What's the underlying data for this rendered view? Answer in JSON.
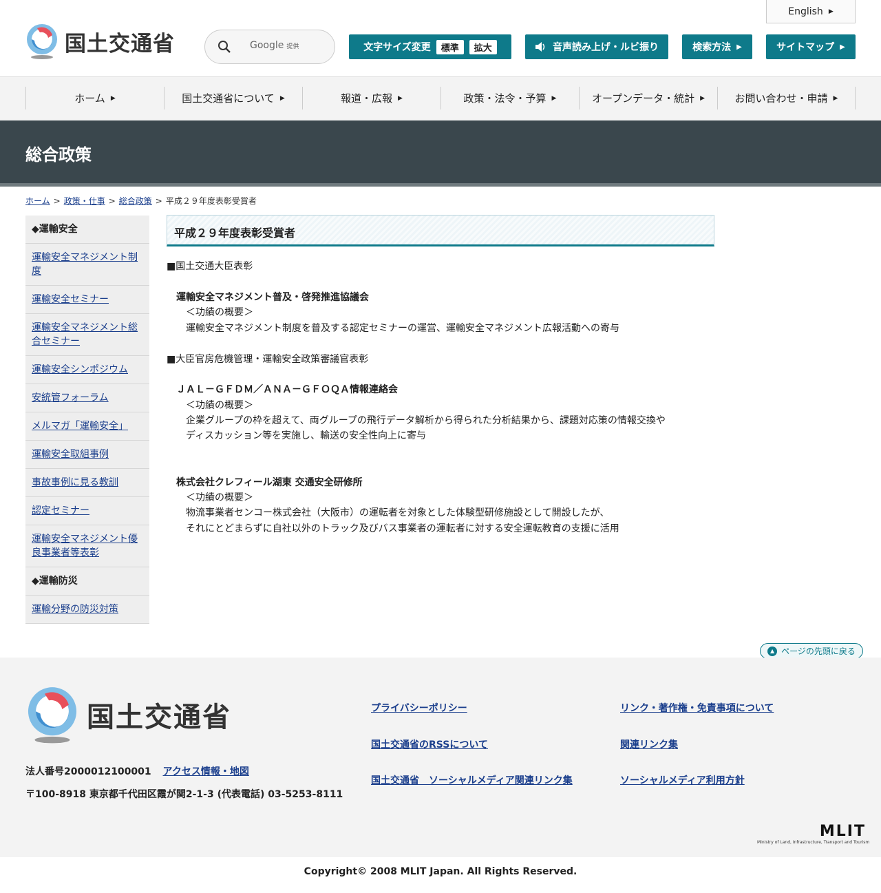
{
  "header": {
    "logo_text": "国土交通省",
    "search_brand": "Google",
    "search_provided": "提供",
    "english_label": "English",
    "font_size_label": "文字サイズ変更",
    "font_standard": "標準",
    "font_large": "拡大",
    "readaloud_label": "音声読み上げ・ルビ振り",
    "search_method_label": "検索方法",
    "sitemap_label": "サイトマップ"
  },
  "nav": {
    "items": [
      {
        "label": "ホーム"
      },
      {
        "label": "国土交通省について"
      },
      {
        "label": "報道・広報"
      },
      {
        "label": "政策・法令・予算"
      },
      {
        "label": "オープンデータ・統計"
      },
      {
        "label": "お問い合わせ・申請"
      }
    ]
  },
  "banner": {
    "title": "総合政策"
  },
  "breadcrumb": {
    "home": "ホーム",
    "policy": "政策・仕事",
    "general": "総合政策",
    "current": "平成２９年度表彰受賞者"
  },
  "sidebar": {
    "head1": "◆運輸安全",
    "items1": [
      "運輸安全マネジメント制度",
      "運輸安全セミナー",
      "運輸安全マネジメント総合セミナー",
      "運輸安全シンポジウム",
      "安統管フォーラム",
      "メルマガ「運輸安全」",
      "運輸安全取組事例",
      "事故事例に見る教訓",
      "認定セミナー",
      "運輸安全マネジメント優良事業者等表彰"
    ],
    "head2": "◆運輸防災",
    "items2": [
      "運輸分野の防災対策"
    ]
  },
  "main": {
    "title": "平成２９年度表彰受賞者",
    "sec1_heading": "■国土交通大臣表彰",
    "sec1_org": "運輸安全マネジメント普及・啓発推進協議会",
    "sec1_summary_label": "＜功績の概要＞",
    "sec1_summary": "運輸安全マネジメント制度を普及する認定セミナーの運営、運輸安全マネジメント広報活動への寄与",
    "sec2_heading": "■大臣官房危機管理・運輸安全政策審議官表彰",
    "sec2_org1": "ＪＡＬ－ＧＦＤＭ／ＡＮＡ－ＧＦＯＱＡ情報連絡会",
    "sec2_org1_summary_label": "＜功績の概要＞",
    "sec2_org1_line1": "企業グループの枠を超えて、両グループの飛行データ解析から得られた分析結果から、課題対応策の情報交換や",
    "sec2_org1_line2": "ディスカッション等を実施し、輸送の安全性向上に寄与",
    "sec2_org2": "株式会社クレフィール湖東 交通安全研修所",
    "sec2_org2_summary_label": "＜功績の概要＞",
    "sec2_org2_line1": "物流事業者センコー株式会社（大阪市）の運転者を対象とした体験型研修施設として開設したが、",
    "sec2_org2_line2": "それにとどまらずに自社以外のトラック及びバス事業者の運転者に対する安全運転教育の支援に活用"
  },
  "totop": {
    "label": "ページの先頭に戻る"
  },
  "footer": {
    "logo_text": "国土交通省",
    "corp_number": "法人番号2000012100001",
    "access_link": "アクセス情報・地図",
    "address": "〒100-8918 東京都千代田区霞が関2-1-3 (代表電話) 03-5253-8111",
    "links": {
      "privacy": "プライバシーポリシー",
      "link_copyright": "リンク・著作権・免責事項について",
      "rss": "国土交通省のRSSについて",
      "related": "関連リンク集",
      "social_links": "国土交通省　ソーシャルメディア関連リンク集",
      "social_policy": "ソーシャルメディア利用方針"
    },
    "mlit_mark": "MLIT",
    "mlit_sub": "Ministry of Land, Infrastructure, Transport and Tourism",
    "copyright": "Copyright© 2008 MLIT Japan. All Rights Reserved."
  }
}
